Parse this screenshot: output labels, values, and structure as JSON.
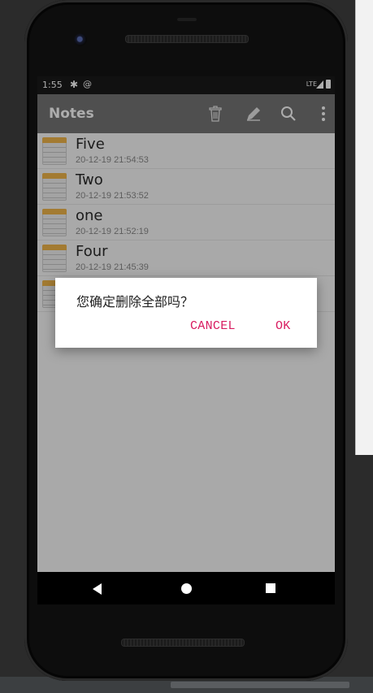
{
  "status_bar": {
    "time": "1:55",
    "network": "LTE"
  },
  "app_bar": {
    "title": "Notes"
  },
  "notes": [
    {
      "title": "Five",
      "date": "20-12-19 21:54:53"
    },
    {
      "title": "Two",
      "date": "20-12-19 21:53:52"
    },
    {
      "title": "one",
      "date": "20-12-19 21:52:19"
    },
    {
      "title": "Four",
      "date": "20-12-19 21:45:39"
    },
    {
      "title": "",
      "date": ""
    }
  ],
  "dialog": {
    "message": "您确定删除全部吗？",
    "cancel_label": "CANCEL",
    "ok_label": "OK"
  },
  "icons": {
    "status": [
      "gear-icon",
      "at-icon",
      "signal-icon",
      "battery-icon"
    ],
    "app_bar": [
      "trash-icon",
      "edit-icon",
      "search-icon",
      "more-vert-icon"
    ],
    "nav": [
      "back-icon",
      "home-icon",
      "recents-icon"
    ]
  },
  "colors": {
    "app_bar": "#757575",
    "accent": "#d81b60",
    "note_icon_top": "#f0b64a"
  }
}
